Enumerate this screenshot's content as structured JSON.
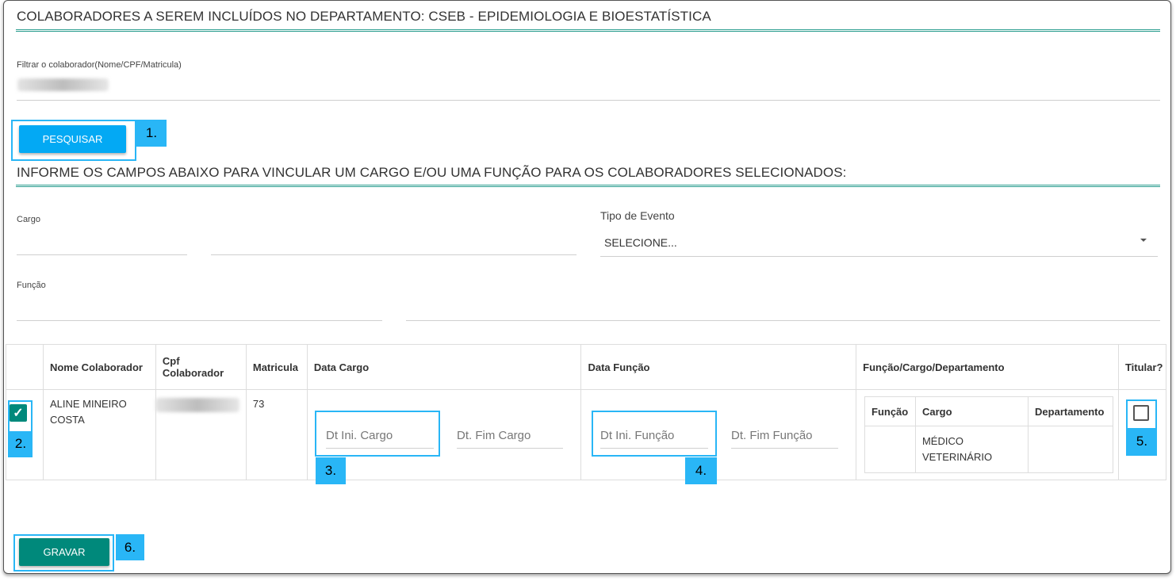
{
  "header": {
    "title": "COLABORADORES A SEREM INCLUÍDOS NO DEPARTAMENTO: CSEB - EPIDEMIOLOGIA E BIOESTATÍSTICA"
  },
  "filter": {
    "label": "Filtrar o colaborador(Nome/CPF/Matricula)"
  },
  "buttons": {
    "search": "PESQUISAR",
    "save": "GRAVAR"
  },
  "link_section": {
    "title": "INFORME OS CAMPOS ABAIXO PARA VINCULAR UM CARGO E/OU UMA FUNÇÃO PARA OS COLABORADORES SELECIONADOS:",
    "cargo_label": "Cargo",
    "funcao_label": "Função",
    "tipo_evento_label": "Tipo de Evento",
    "tipo_evento_value": "SELECIONE..."
  },
  "table": {
    "headers": [
      "",
      "Nome Colaborador",
      "Cpf Colaborador",
      "Matricula",
      "Data Cargo",
      "Data Função",
      "Função/Cargo/Departamento",
      "Titular?"
    ],
    "rows": [
      {
        "selected": true,
        "name": "ALINE MINEIRO COSTA",
        "matricula": "73",
        "dt_ini_cargo_placeholder": "Dt Ini. Cargo",
        "dt_fim_cargo_placeholder": "Dt. Fim Cargo",
        "dt_ini_funcao_placeholder": "Dt Ini. Função",
        "dt_fim_funcao_placeholder": "Dt. Fim Função",
        "inner_headers": [
          "Função",
          "Cargo",
          "Departamento"
        ],
        "inner_row": {
          "funcao": "",
          "cargo": "MÉDICO VETERINÁRIO",
          "departamento": ""
        },
        "titular": false
      }
    ]
  },
  "annotations": [
    "1.",
    "2.",
    "3.",
    "4.",
    "5.",
    "6."
  ],
  "colors": {
    "primary_button": "#03a9f4",
    "save_button": "#00897b",
    "highlight": "#29b6f6",
    "title_line": "#2a9d8f"
  }
}
